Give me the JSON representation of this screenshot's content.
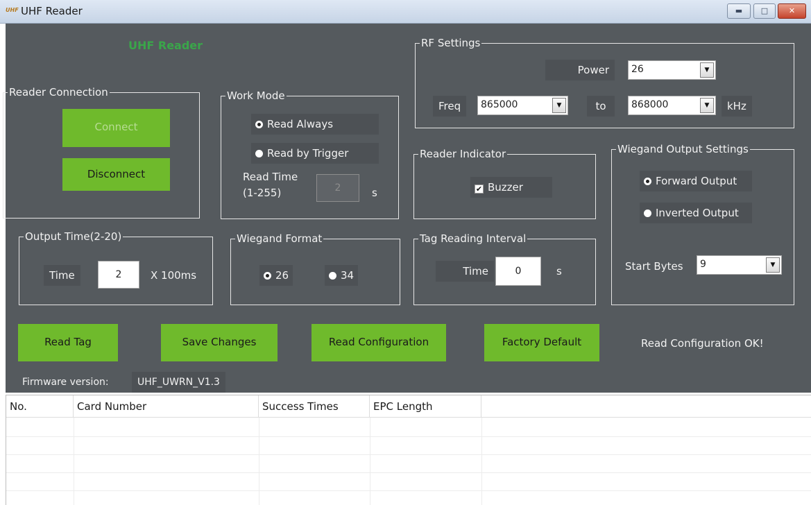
{
  "window": {
    "title": "UHF Reader",
    "icon_text": "UHF"
  },
  "logo_text": "UHF Reader",
  "reader_connection": {
    "title": "Reader Connection",
    "connect_label": "Connect",
    "disconnect_label": "Disconnect"
  },
  "work_mode": {
    "title": "Work Mode",
    "option_always": "Read Always",
    "option_trigger": "Read by Trigger",
    "selected": "Read Always",
    "read_time_label": "Read Time",
    "read_time_range": "(1-255)",
    "read_time_value": "2",
    "read_time_unit": "s"
  },
  "rf_settings": {
    "title": "RF Settings",
    "power_label": "Power",
    "power_value": "26",
    "freq_label": "Freq",
    "freq_from": "865000",
    "to_label": "to",
    "freq_to": "868000",
    "freq_unit": "kHz"
  },
  "reader_indicator": {
    "title": "Reader Indicator",
    "buzzer_label": "Buzzer",
    "buzzer_checked": true
  },
  "wiegand_output": {
    "title": "Wiegand Output Settings",
    "forward_label": "Forward Output",
    "inverted_label": "Inverted Output",
    "selected": "Forward Output",
    "start_bytes_label": "Start Bytes",
    "start_bytes_value": "9"
  },
  "output_time": {
    "title": "Output Time(2-20)",
    "time_label": "Time",
    "time_value": "2",
    "unit": "X 100ms"
  },
  "wiegand_format": {
    "title": "Wiegand Format",
    "option_26": "26",
    "option_34": "34",
    "selected": "26"
  },
  "tag_interval": {
    "title": "Tag Reading Interval",
    "time_label": "Time",
    "time_value": "0",
    "unit": "s"
  },
  "actions": {
    "read_tag": "Read Tag",
    "save_changes": "Save Changes",
    "read_configuration": "Read Configuration",
    "factory_default": "Factory Default",
    "status": "Read Configuration OK!"
  },
  "firmware": {
    "label": "Firmware version:",
    "value": "UHF_UWRN_V1.3"
  },
  "table": {
    "columns": [
      "No.",
      "Card Number",
      "Success Times",
      "EPC Length"
    ]
  },
  "colors": {
    "panel": "#555a5e",
    "button_green": "#6fba2c",
    "logo_green": "#3aa64a"
  }
}
